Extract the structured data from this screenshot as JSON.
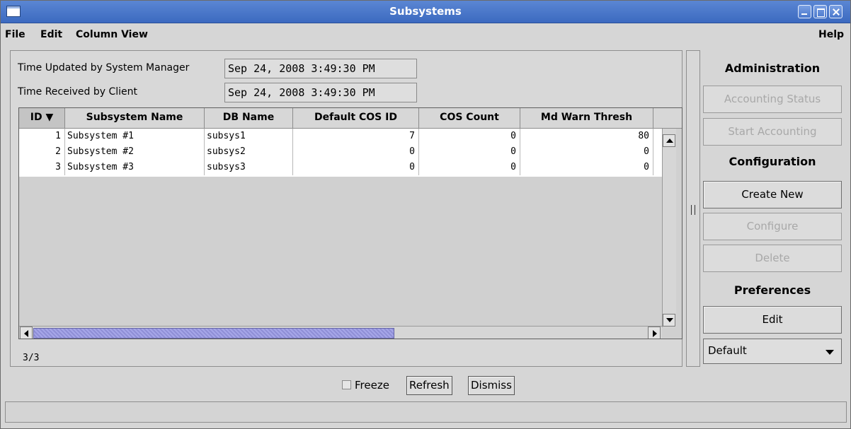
{
  "window": {
    "title": "Subsystems"
  },
  "menubar": {
    "file": "File",
    "edit": "Edit",
    "column_view": "Column View",
    "help": "Help"
  },
  "info": {
    "time_updated_label": "Time Updated by System Manager",
    "time_updated_value": "Sep 24, 2008 3:49:30 PM",
    "time_received_label": "Time Received by Client",
    "time_received_value": "Sep 24, 2008 3:49:30 PM"
  },
  "table": {
    "columns": [
      "ID ▼",
      "Subsystem Name",
      "DB Name",
      "Default COS ID",
      "COS Count",
      "Md Warn Thresh"
    ],
    "rows": [
      [
        "1",
        "Subsystem #1",
        "subsys1",
        "7",
        "0",
        "80"
      ],
      [
        "2",
        "Subsystem #2",
        "subsys2",
        "0",
        "0",
        "0"
      ],
      [
        "3",
        "Subsystem #3",
        "subsys3",
        "0",
        "0",
        "0"
      ]
    ],
    "count": "3/3"
  },
  "actions": {
    "administration": "Administration",
    "accounting_status": "Accounting Status",
    "start_accounting": "Start Accounting",
    "configuration": "Configuration",
    "create_new": "Create New",
    "configure": "Configure",
    "delete": "Delete",
    "preferences": "Preferences",
    "edit": "Edit",
    "preference_select": "Default"
  },
  "bottom": {
    "freeze": "Freeze",
    "refresh": "Refresh",
    "dismiss": "Dismiss"
  },
  "icons": [
    "window-icon",
    "minimize-icon",
    "maximize-icon",
    "close-icon",
    "scroll-up-icon",
    "scroll-down-icon",
    "scroll-left-icon",
    "scroll-right-icon",
    "dropdown-arrow-icon"
  ]
}
